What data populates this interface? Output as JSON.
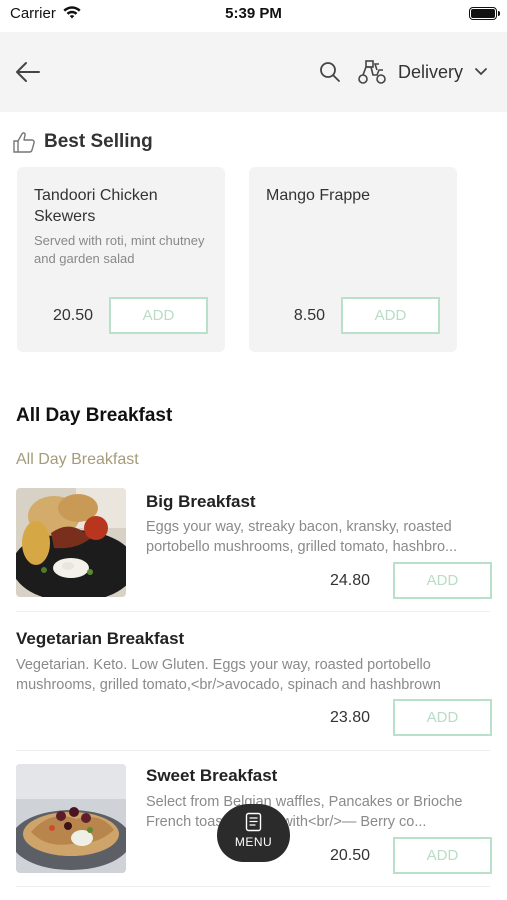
{
  "status_bar": {
    "carrier": "Carrier",
    "time": "5:39 PM"
  },
  "header": {
    "delivery_label": "Delivery"
  },
  "best_selling": {
    "title": "Best Selling",
    "items": [
      {
        "name": "Tandoori Chicken Skewers",
        "description": "Served with roti, mint chutney and garden salad",
        "price": "20.50",
        "add_label": "ADD"
      },
      {
        "name": "Mango Frappe",
        "description": "",
        "price": "8.50",
        "add_label": "ADD"
      }
    ]
  },
  "section": {
    "title": "All Day Breakfast",
    "subtitle": "All Day Breakfast",
    "items": [
      {
        "name": "Big Breakfast",
        "description_line1": "Eggs your way, streaky bacon, kransky, roasted",
        "description_line2": "portobello mushrooms, grilled tomato, hashbro...",
        "price": "24.80",
        "add_label": "ADD"
      },
      {
        "name": "Vegetarian Breakfast",
        "description_line1": "Vegetarian. Keto. Low Gluten.  Eggs your way, roasted portobello",
        "description_line2": "mushrooms, grilled tomato,<br/>avocado, spinach and hashbrown",
        "price": "23.80",
        "add_label": "ADD"
      },
      {
        "name": "Sweet Breakfast",
        "description_line1": "Select from Belgian waffles, Pancakes or Brioche",
        "description_line2": "French toast, served with<br/>— Berry co...",
        "price": "20.50",
        "add_label": "ADD"
      }
    ]
  },
  "menu_button": {
    "label": "MENU"
  },
  "colors": {
    "add_border": "#b9e0c8",
    "subtitle": "#a59a7a",
    "header_bg": "#f4f4f4"
  }
}
